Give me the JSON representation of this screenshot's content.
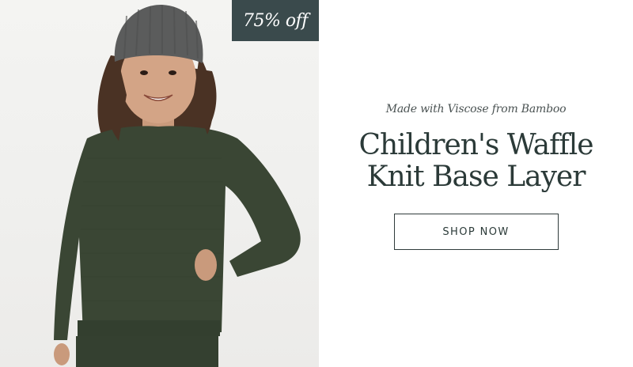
{
  "promo": {
    "discount_label": "75% off",
    "eyebrow": "Made with Viscose from Bamboo",
    "headline_line1": "Children's Waffle",
    "headline_line2": "Knit Base Layer",
    "cta_label": "SHOP NOW"
  },
  "colors": {
    "badge_bg": "#3a4a4c",
    "headline": "#2b3a38",
    "sweater": "#3a4634",
    "beanie": "#5b5c5c"
  }
}
